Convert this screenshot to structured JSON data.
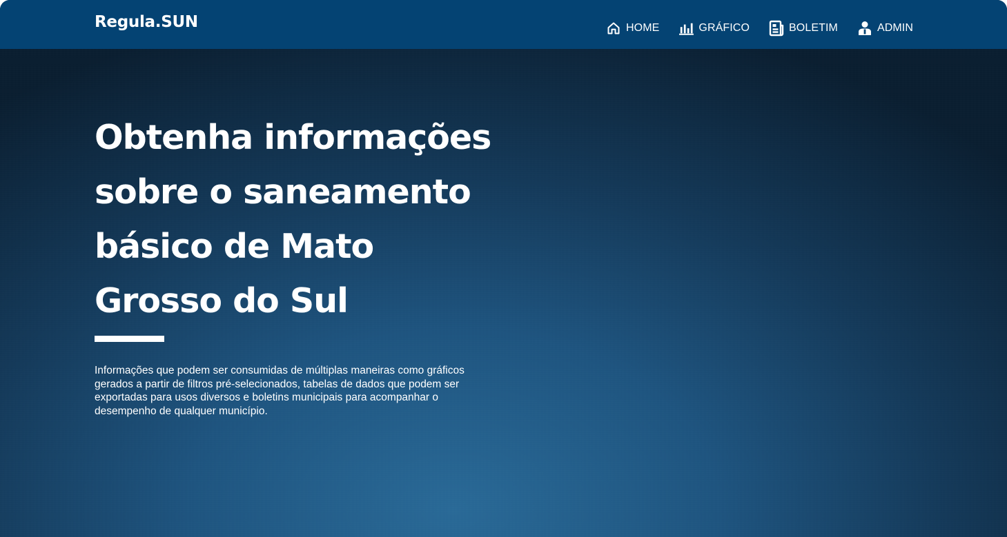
{
  "brand": "Regula.SUN",
  "nav": {
    "items": [
      {
        "label": "HOME",
        "icon": "home-icon"
      },
      {
        "label": "GRÁFICO",
        "icon": "bar-chart-icon"
      },
      {
        "label": "BOLETIM",
        "icon": "newspaper-icon"
      },
      {
        "label": "ADMIN",
        "icon": "admin-user-icon"
      }
    ]
  },
  "hero": {
    "title": "Obtenha informações sobre o saneamento básico de Mato Grosso do Sul",
    "description": "Informações que podem ser consumidas de múltiplas maneiras como gráficos gerados a partir de filtros pré-selecionados, tabelas de dados que podem ser exportadas para usos diversos e boletins municipais para acompanhar o desempenho de qualquer município."
  },
  "colors": {
    "navbar": "#044373",
    "text": "#ffffff",
    "background_center": "#2a6a98",
    "background_edge": "#0b1f31"
  }
}
